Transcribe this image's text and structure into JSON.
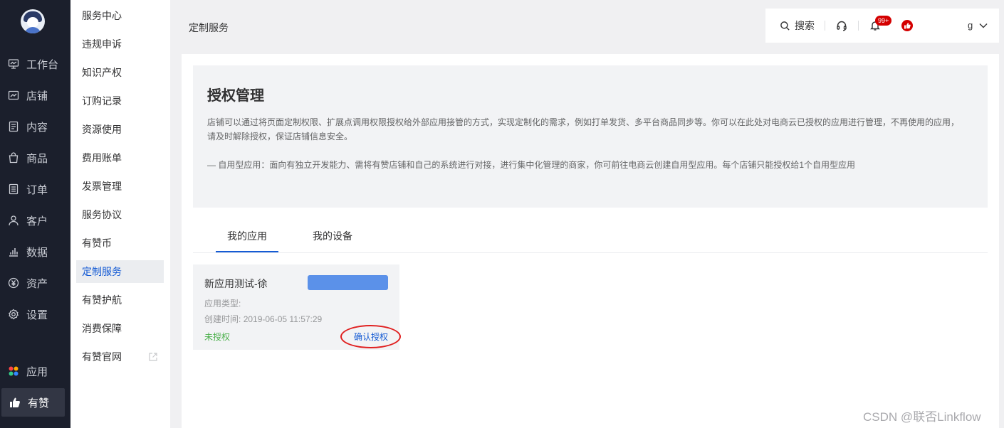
{
  "nav": {
    "items": [
      {
        "label": "工作台",
        "icon": "dashboard-icon"
      },
      {
        "label": "店铺",
        "icon": "store-icon"
      },
      {
        "label": "内容",
        "icon": "content-icon"
      },
      {
        "label": "商品",
        "icon": "bag-icon"
      },
      {
        "label": "订单",
        "icon": "order-icon"
      },
      {
        "label": "客户",
        "icon": "customer-icon"
      },
      {
        "label": "数据",
        "icon": "chart-icon"
      },
      {
        "label": "资产",
        "icon": "yen-icon"
      },
      {
        "label": "设置",
        "icon": "gear-icon"
      }
    ],
    "apps_label": "应用",
    "youzan_label": "有赞"
  },
  "subnav": {
    "items": [
      "服务中心",
      "违规申诉",
      "知识产权",
      "订购记录",
      "资源使用",
      "费用账单",
      "发票管理",
      "服务协议",
      "有赞币",
      "定制服务",
      "有赞护航",
      "消费保障",
      "有赞官网"
    ],
    "active": "定制服务"
  },
  "header": {
    "page_title": "定制服务",
    "search_label": "搜索",
    "notification_badge": "99+",
    "user_name_fragment": "g"
  },
  "info": {
    "title": "授权管理",
    "desc": "店铺可以通过将页面定制权限、扩展点调用权限授权给外部应用接管的方式，实现定制化的需求，例如打单发货、多平台商品同步等。你可以在此处对电商云已授权的应用进行管理，不再使用的应用，请及时解除授权，保证店铺信息安全。",
    "note": "— 自用型应用：面向有独立开发能力、需将有赞店铺和自己的系统进行对接，进行集中化管理的商家，你可前往电商云创建自用型应用。每个店铺只能授权给1个自用型应用"
  },
  "tabs": {
    "my_apps": "我的应用",
    "my_devices": "我的设备",
    "active": "我的应用"
  },
  "card": {
    "name": "新应用测试-徐",
    "type_label": "应用类型:",
    "time_label": "创建时间:",
    "time_value": "2019-06-05 11:57:29",
    "status": "未授权",
    "action": "确认授权"
  },
  "watermark": "CSDN @联否Linkflow",
  "colors": {
    "accent": "#155bd4",
    "nav_bg": "#1b1f2c",
    "status_green": "#4bb04b",
    "badge_red": "#d40000"
  }
}
